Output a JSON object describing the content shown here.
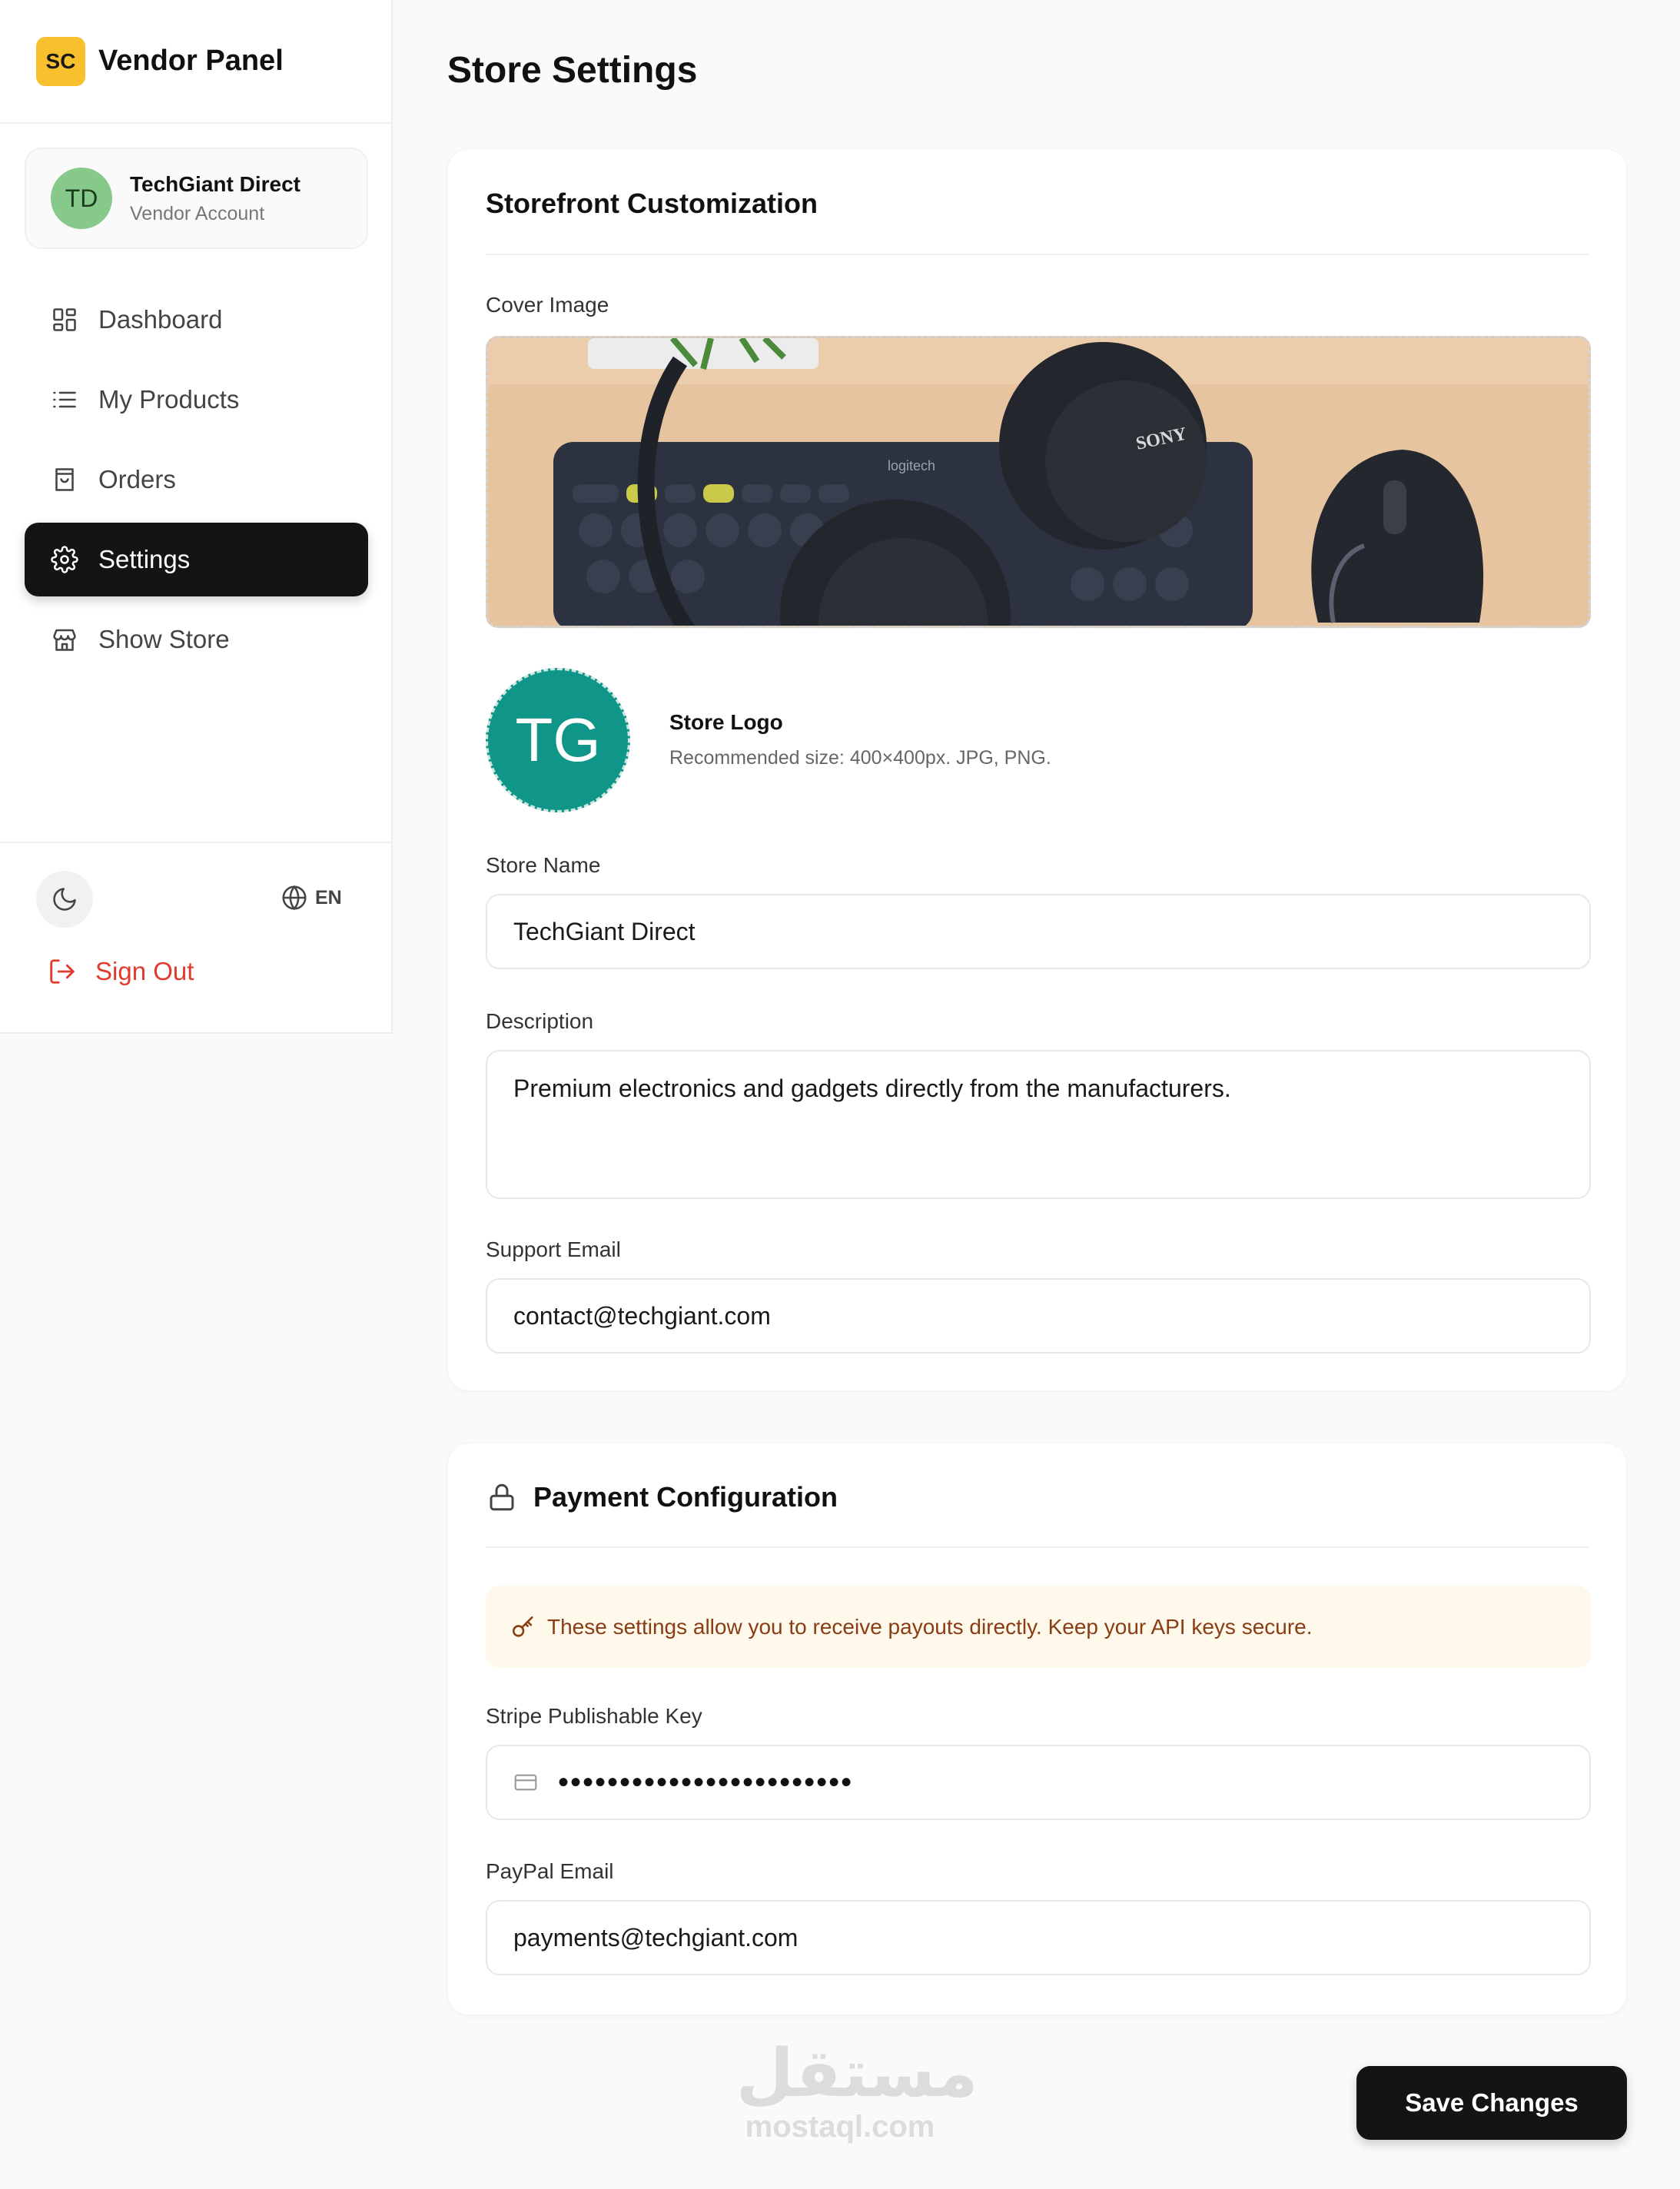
{
  "brand": {
    "badge": "SC",
    "title": "Vendor Panel",
    "badge_color": "#f8c02c"
  },
  "account": {
    "initials": "TD",
    "name": "TechGiant Direct",
    "role": "Vendor Account"
  },
  "nav": {
    "items": [
      {
        "label": "Dashboard",
        "icon": "dashboard-icon"
      },
      {
        "label": "My Products",
        "icon": "list-icon"
      },
      {
        "label": "Orders",
        "icon": "shopping-bag-icon"
      },
      {
        "label": "Settings",
        "icon": "gear-icon",
        "active": true
      },
      {
        "label": "Show Store",
        "icon": "store-icon"
      }
    ]
  },
  "footer": {
    "language": "EN",
    "sign_out": "Sign Out",
    "sign_out_color": "#e23b2e"
  },
  "page": {
    "title": "Store Settings"
  },
  "storefront": {
    "title": "Storefront Customization",
    "cover_label": "Cover Image",
    "cover_content": "photo: keyboard, headphones and mouse on desk",
    "logo_initials": "TG",
    "logo_color": "#0f9688",
    "logo_title": "Store Logo",
    "logo_hint": "Recommended size: 400×400px. JPG, PNG.",
    "store_name_label": "Store Name",
    "store_name": "TechGiant Direct",
    "description_label": "Description",
    "description": "Premium electronics and gadgets directly from the manufacturers.",
    "support_email_label": "Support Email",
    "support_email": "contact@techgiant.com"
  },
  "payment": {
    "title": "Payment Configuration",
    "notice": "These settings allow you to receive payouts directly. Keep your API keys secure.",
    "stripe_label": "Stripe Publishable Key",
    "stripe_masked": "••••••••••••••••••••••••",
    "paypal_label": "PayPal Email",
    "paypal_email": "payments@techgiant.com"
  },
  "actions": {
    "save": "Save Changes"
  },
  "watermark": {
    "arabic": "مستقل",
    "latin": "mostaql.com"
  }
}
